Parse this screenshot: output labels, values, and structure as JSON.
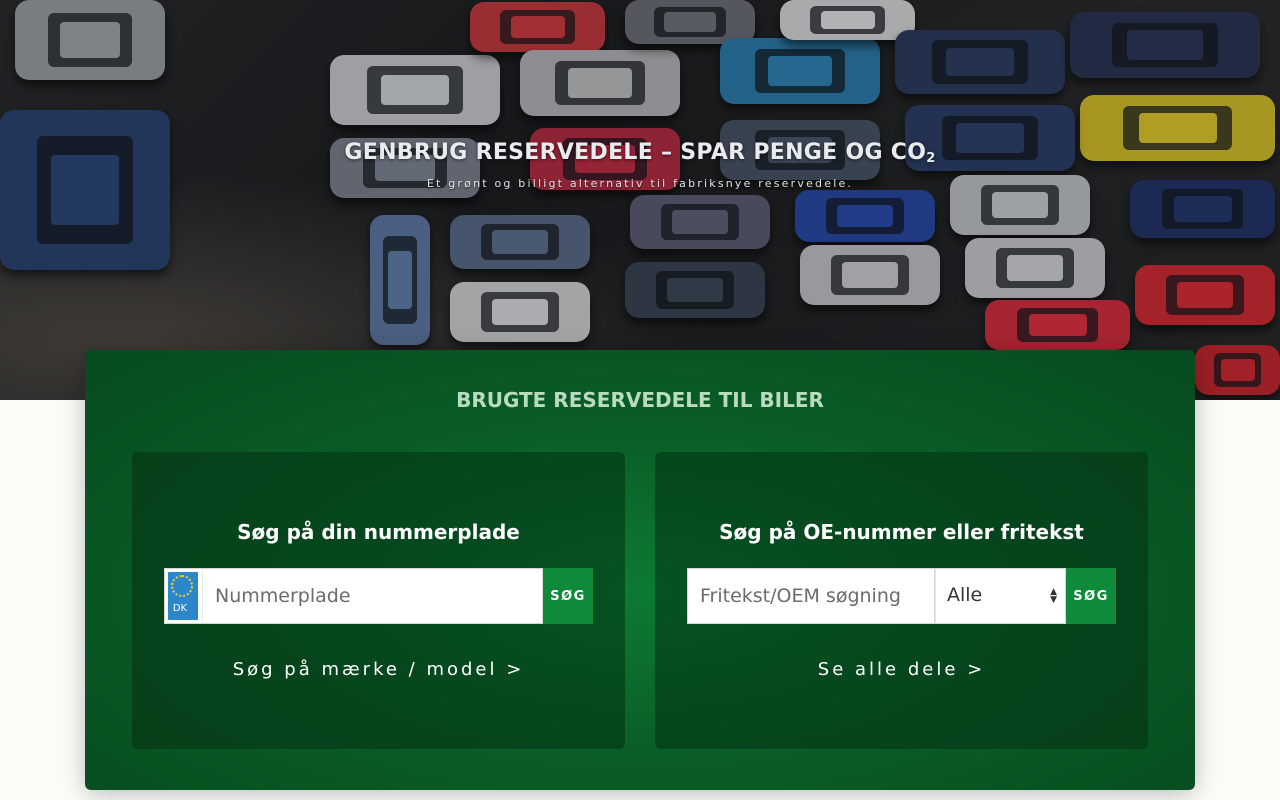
{
  "hero": {
    "title": "GENBRUG RESERVEDELE – SPAR PENGE OG CO",
    "title_sub": "2",
    "subtitle": "Et grønt og billigt alternativ til fabriksnye reservedele."
  },
  "panel": {
    "title": "BRUGTE RESERVEDELE TIL BILER"
  },
  "plate_search": {
    "title": "Søg på din nummerplade",
    "country_code": "DK",
    "placeholder": "Nummerplade",
    "button_label": "SØG",
    "link_label": "Søg på mærke / model  >"
  },
  "text_search": {
    "title": "Søg på OE-nummer eller fritekst",
    "placeholder": "Fritekst/OEM søgning",
    "select_value": "Alle",
    "button_label": "SØG",
    "link_label": "Se alle dele  >"
  },
  "colors": {
    "accent_green": "#0e8a3a",
    "panel_green": "#0a5f28",
    "eu_blue": "#2b87c9"
  },
  "icons": {
    "select": "updown-arrows-icon",
    "flag": "eu-stars-icon"
  }
}
